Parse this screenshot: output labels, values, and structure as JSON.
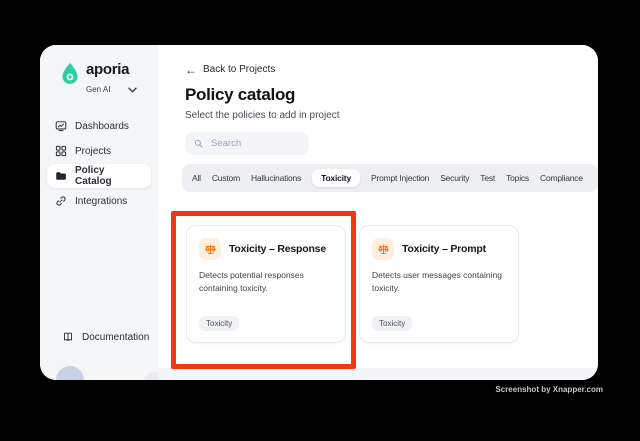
{
  "sidebar": {
    "brand": "aporia",
    "workspace": "Gen AI",
    "items": [
      {
        "label": "Dashboards",
        "icon": "dashboard-icon",
        "active": false
      },
      {
        "label": "Projects",
        "icon": "projects-grid-icon",
        "active": false
      },
      {
        "label": "Policy Catalog",
        "icon": "folder-icon",
        "active": true
      },
      {
        "label": "Integrations",
        "icon": "link-icon",
        "active": false
      }
    ],
    "documentation_label": "Documentation"
  },
  "main": {
    "back_label": "Back to Projects",
    "back_arrow": "←",
    "title": "Policy catalog",
    "subtitle": "Select the policies to add in project",
    "search": {
      "placeholder": "Search"
    },
    "tabs": [
      {
        "label": "All",
        "active": false
      },
      {
        "label": "Custom",
        "active": false
      },
      {
        "label": "Hallucinations",
        "active": false
      },
      {
        "label": "Toxicity",
        "active": true
      },
      {
        "label": "Prompt Injection",
        "active": false
      },
      {
        "label": "Security",
        "active": false
      },
      {
        "label": "Test",
        "active": false
      },
      {
        "label": "Topics",
        "active": false
      },
      {
        "label": "Compliance",
        "active": false
      }
    ],
    "cards": [
      {
        "title": "Toxicity – Response",
        "description": "Detects potential responses containing toxicity.",
        "tag": "Toxicity",
        "icon": "scales-icon",
        "highlighted": true
      },
      {
        "title": "Toxicity – Prompt",
        "description": "Detects user messages containing toxicity.",
        "tag": "Toxicity",
        "icon": "scales-icon",
        "highlighted": false
      }
    ]
  },
  "watermark": "Screenshot by Xnapper.com",
  "colors": {
    "brand_teal": "#2bd0a2",
    "icon_orange": "#f97316",
    "icon_orange_bg": "#fdeedd",
    "annotation_red": "#f23713",
    "sidebar_bg": "#f5f6f8",
    "tabs_bg": "#edeff3",
    "outer_bg": "#000000"
  }
}
